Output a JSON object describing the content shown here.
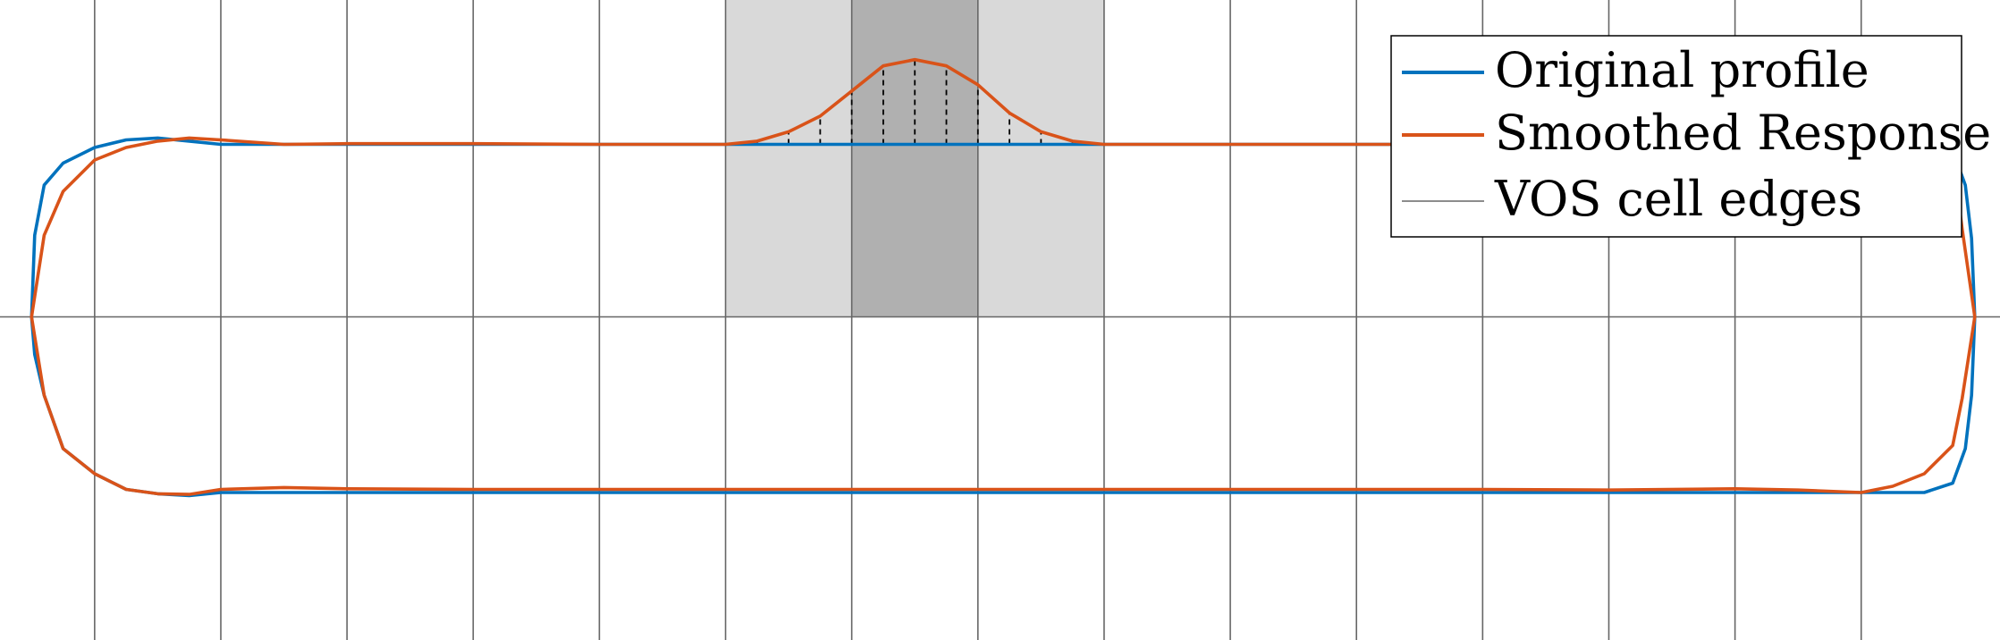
{
  "chart_data": {
    "type": "line",
    "title": "",
    "xlabel": "",
    "ylabel": "",
    "xlim": [
      -7.5,
      24.2
    ],
    "ylim": [
      -5.15,
      5.05
    ],
    "grid": false,
    "legend_position": "top-right",
    "cell_edges_x": [
      -6,
      -4,
      -2,
      0,
      2,
      4,
      6,
      8,
      10,
      12,
      14,
      16,
      18,
      20,
      22
    ],
    "axis_y0": 0,
    "shaded_regions": [
      {
        "x_range": [
          4,
          10
        ],
        "shade": "light",
        "color": "#d9d9d9"
      },
      {
        "x_range": [
          6,
          8
        ],
        "shade": "dark",
        "color": "#b0b0b0"
      }
    ],
    "series": [
      {
        "name": "Original profile",
        "color": "#0072bd",
        "x": [
          -7.0,
          -6.95,
          -6.8,
          -6.5,
          -6.0,
          -5.5,
          -5.0,
          -4.5,
          -4.0,
          23.0,
          23.45,
          23.65,
          23.75,
          23.8,
          23.75,
          23.65,
          23.45,
          23.0,
          22.5,
          22.0,
          21.5,
          21.0,
          18.0,
          14.0,
          10.0,
          6.0,
          2.0,
          -2.0,
          -4.0,
          -4.5,
          -5.0,
          -5.5,
          -6.0,
          -6.5,
          -6.8,
          -6.95,
          -7.0
        ],
        "y": [
          0.0,
          -0.6,
          -1.25,
          -2.1,
          -2.5,
          -2.75,
          -2.82,
          -2.85,
          -2.8,
          -2.8,
          -2.65,
          -2.1,
          -1.25,
          0.0,
          1.25,
          2.1,
          2.65,
          2.75,
          2.75,
          2.75,
          2.75,
          2.75,
          2.75,
          2.75,
          2.75,
          2.75,
          2.75,
          2.75,
          2.75,
          2.8,
          2.85,
          2.82,
          2.7,
          2.45,
          2.1,
          1.3,
          0.0
        ]
      },
      {
        "name": "Smoothed Response",
        "color": "#d95319",
        "x": [
          -7.0,
          -6.8,
          -6.5,
          -6.0,
          -5.5,
          -5.0,
          -4.5,
          -4.0,
          -3.0,
          -2.0,
          0.0,
          2.0,
          4.0,
          4.5,
          5.0,
          5.5,
          6.0,
          6.5,
          7.0,
          7.5,
          8.0,
          8.5,
          9.0,
          9.5,
          10.0,
          12.0,
          14.0,
          16.0,
          18.0,
          20.0,
          21.5,
          22.0,
          22.5,
          23.0,
          23.5,
          23.6,
          23.8,
          23.6,
          23.45,
          23.0,
          22.5,
          22.0,
          21.0,
          20.0,
          18.0,
          16.0,
          14.0,
          12.0,
          10.0,
          8.0,
          6.0,
          4.0,
          2.0,
          0.0,
          -2.0,
          -3.0,
          -4.0,
          -4.5,
          -5.0,
          -5.5,
          -6.0,
          -6.5,
          -6.8,
          -7.0
        ],
        "y": [
          0.0,
          1.3,
          2.0,
          2.5,
          2.7,
          2.8,
          2.85,
          2.82,
          2.75,
          2.76,
          2.76,
          2.75,
          2.75,
          2.8,
          2.95,
          3.2,
          3.6,
          4.0,
          4.1,
          4.0,
          3.7,
          3.25,
          2.95,
          2.8,
          2.75,
          2.75,
          2.75,
          2.75,
          2.75,
          2.75,
          2.75,
          2.75,
          2.75,
          2.75,
          2.2,
          1.4,
          0.0,
          -1.3,
          -2.05,
          -2.5,
          -2.7,
          -2.8,
          -2.76,
          -2.74,
          -2.76,
          -2.75,
          -2.75,
          -2.75,
          -2.75,
          -2.75,
          -2.75,
          -2.75,
          -2.75,
          -2.75,
          -2.74,
          -2.72,
          -2.75,
          -2.83,
          -2.82,
          -2.75,
          -2.5,
          -2.1,
          -1.25,
          0.0
        ]
      }
    ],
    "smoothing_stems": {
      "x": [
        4.5,
        5.0,
        5.5,
        6.0,
        6.5,
        7.0,
        7.5,
        8.0,
        8.5,
        9.0,
        9.5
      ],
      "base": 2.75
    },
    "legend": [
      {
        "label": "Original profile",
        "style": "line",
        "color": "#0072bd"
      },
      {
        "label": "Smoothed Response",
        "style": "line",
        "color": "#d95319"
      },
      {
        "label": "VOS cell edges",
        "style": "thin-line",
        "color": "#666666"
      }
    ]
  }
}
